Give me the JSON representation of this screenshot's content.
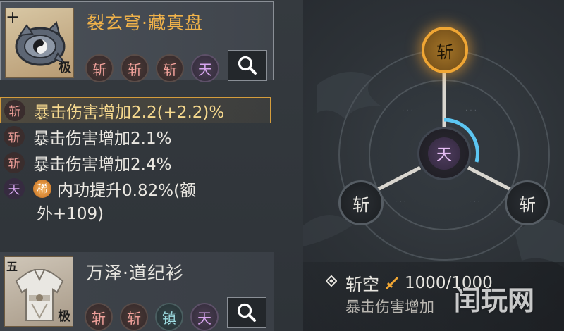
{
  "items": [
    {
      "rank": "十",
      "tier": "极",
      "name": "裂玄穹·藏真盘",
      "slots": [
        "斩",
        "斩",
        "斩",
        "天"
      ]
    },
    {
      "rank": "五",
      "tier": "极",
      "name": "万泽·道纪衫",
      "slots": [
        "斩",
        "斩",
        "镇",
        "天"
      ]
    }
  ],
  "stats": [
    {
      "icon": "斩",
      "text": "暴击伤害增加2.2(+2.2)%"
    },
    {
      "icon": "斩",
      "text": "暴击伤害增加2.1%"
    },
    {
      "icon": "斩",
      "text": "暴击伤害增加2.4%"
    },
    {
      "icon": "天",
      "rare": "稀",
      "text": "内功提升0.82%(额",
      "text_cont": "外+109)"
    }
  ],
  "wheel": {
    "top": "斩",
    "center": "天",
    "left": "斩",
    "right": "斩"
  },
  "skill": {
    "name": "斩空",
    "value": "1000/1000",
    "desc": "暴击伤害增加"
  },
  "watermark": "闰玩网",
  "colors": {
    "gold": "#f0b24a",
    "slash": "#f0a09a",
    "sky": "#d8a6f0",
    "guard": "#9cdbe0"
  }
}
